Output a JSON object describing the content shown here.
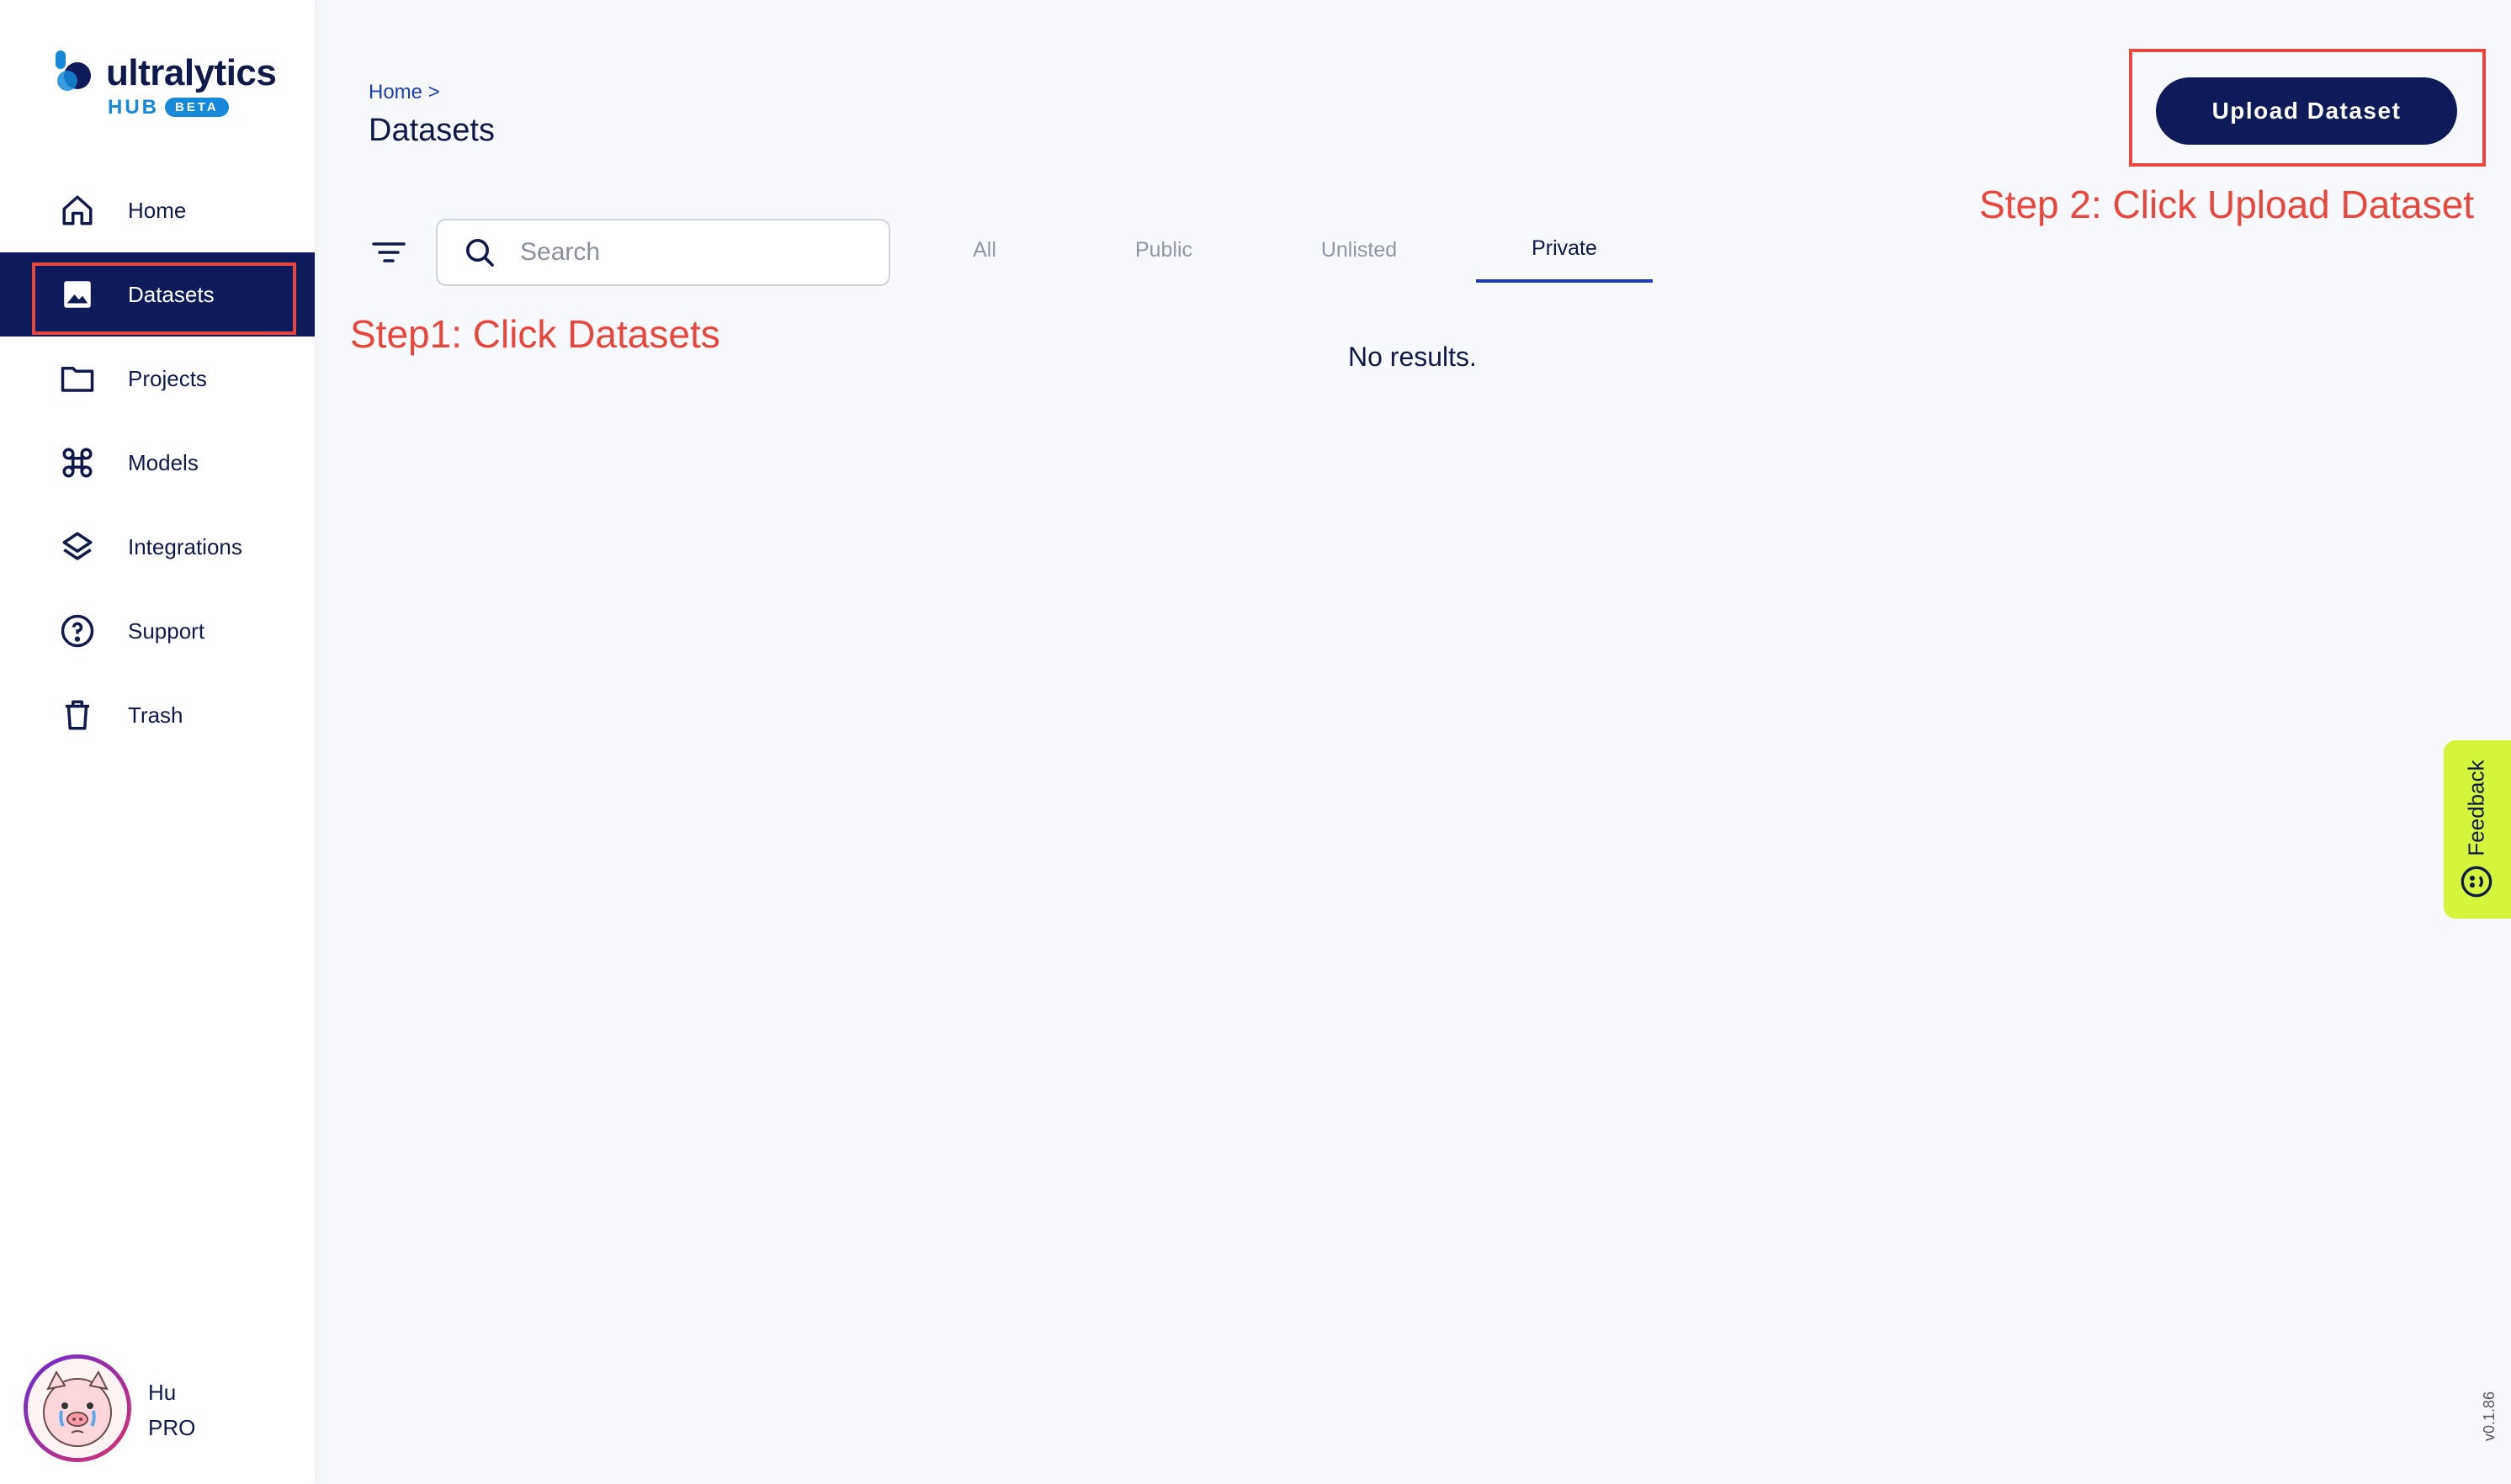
{
  "app": {
    "logo_text": "ultralytics",
    "logo_hub": "HUB",
    "logo_badge": "BETA",
    "brand_color": "#0e1a5a",
    "accent_color": "#1689d8"
  },
  "sidebar": {
    "items": [
      {
        "label": "Home",
        "icon": "home-icon",
        "active": false
      },
      {
        "label": "Datasets",
        "icon": "image-icon",
        "active": true
      },
      {
        "label": "Projects",
        "icon": "folder-icon",
        "active": false
      },
      {
        "label": "Models",
        "icon": "command-icon",
        "active": false
      },
      {
        "label": "Integrations",
        "icon": "layers-icon",
        "active": false
      },
      {
        "label": "Support",
        "icon": "help-circle-icon",
        "active": false
      },
      {
        "label": "Trash",
        "icon": "trash-icon",
        "active": false
      }
    ],
    "user": {
      "name": "Hu",
      "plan": "PRO"
    }
  },
  "header": {
    "breadcrumb": "Home  >",
    "title": "Datasets",
    "upload_label": "Upload Dataset"
  },
  "toolbar": {
    "search_placeholder": "Search",
    "tabs": [
      {
        "label": "All",
        "active": false
      },
      {
        "label": "Public",
        "active": false
      },
      {
        "label": "Unlisted",
        "active": false
      },
      {
        "label": "Private",
        "active": true
      }
    ]
  },
  "content": {
    "empty_message": "No results."
  },
  "annotations": {
    "step1": "Step1: Click Datasets",
    "step2": "Step 2: Click Upload Dataset",
    "color": "#e8473f"
  },
  "feedback": {
    "label": "Feedback"
  },
  "version": "v0.1.86"
}
